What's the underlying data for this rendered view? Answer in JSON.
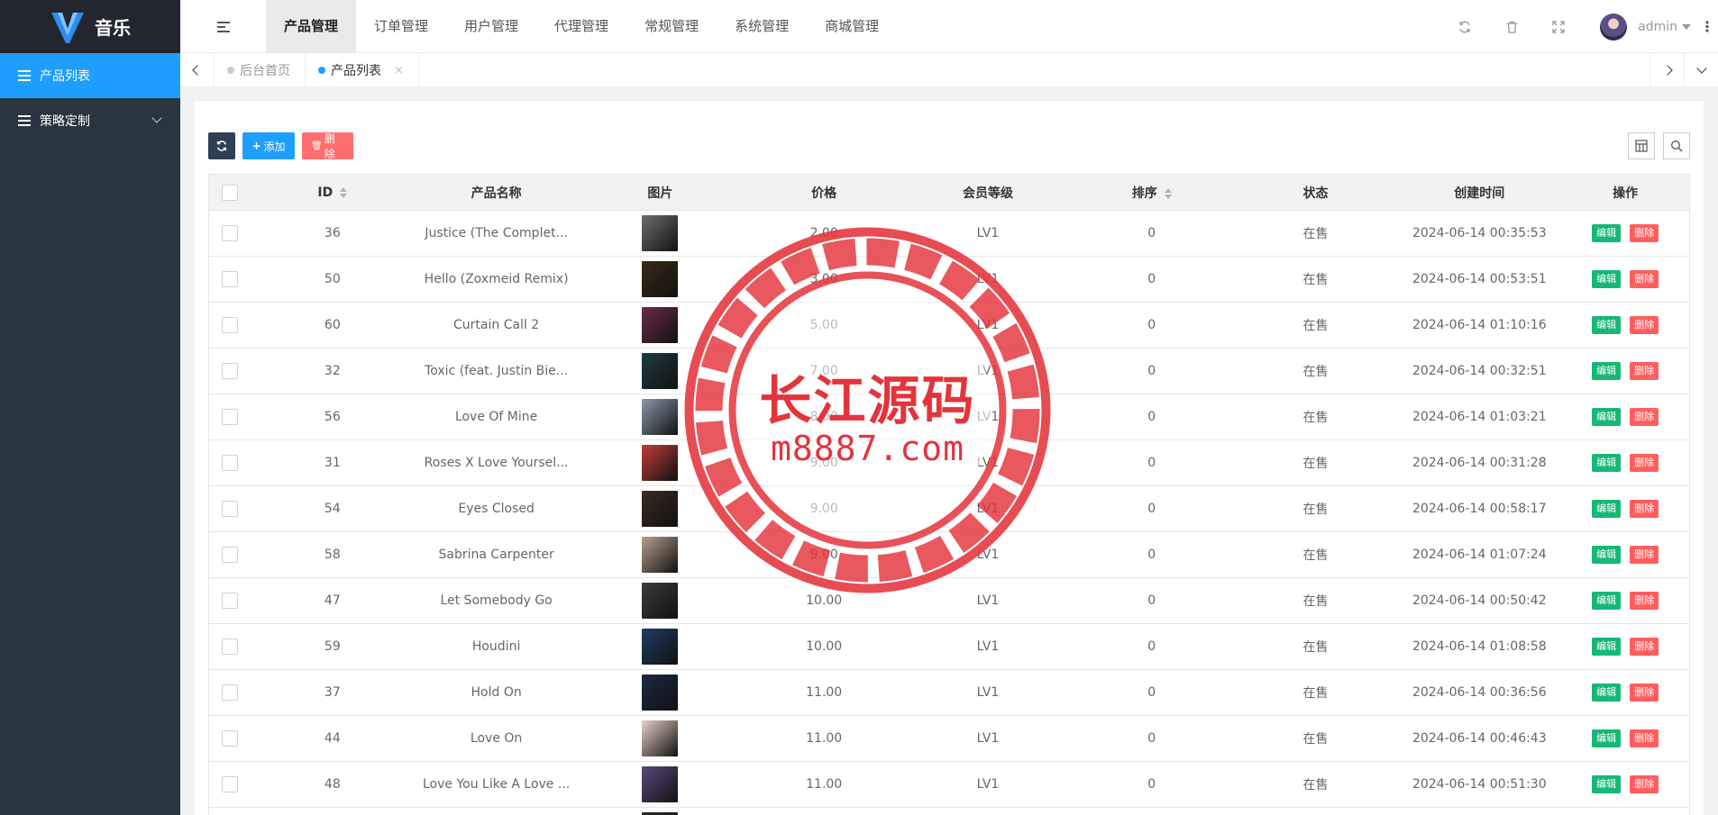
{
  "app": {
    "title": "音乐"
  },
  "sidebar": {
    "items": [
      {
        "label": "产品列表"
      },
      {
        "label": "策略定制"
      }
    ]
  },
  "header": {
    "nav": [
      "产品管理",
      "订单管理",
      "用户管理",
      "代理管理",
      "常规管理",
      "系统管理",
      "商城管理"
    ],
    "username": "admin",
    "more": "⋮"
  },
  "tabs": {
    "items": [
      {
        "label": "后台首页"
      },
      {
        "label": "产品列表",
        "close": "×"
      }
    ]
  },
  "toolbar": {
    "add_label": "添加",
    "delete_label": "删除",
    "add_glyph": "+",
    "delete_glyph": "🗑"
  },
  "table": {
    "headers": {
      "id": "ID",
      "name": "产品名称",
      "image": "图片",
      "price": "价格",
      "level": "会员等级",
      "sort": "排序",
      "status": "状态",
      "created": "创建时间",
      "action": "操作"
    },
    "edit_label": "编辑",
    "delete_label": "删除",
    "rows": [
      {
        "id": "36",
        "name": "Justice (The Complet...",
        "price": "2.00",
        "level": "LV1",
        "sort": "0",
        "status": "在售",
        "created": "2024-06-14 00:35:53",
        "thumb_color": "#6e6e6e"
      },
      {
        "id": "50",
        "name": "Hello (Zoxmeid Remix)",
        "price": "3.00",
        "level": "LV1",
        "sort": "0",
        "status": "在售",
        "created": "2024-06-14 00:53:51",
        "thumb_color": "#3a2a14"
      },
      {
        "id": "60",
        "name": "Curtain Call 2",
        "price": "5.00",
        "level": "LV1",
        "sort": "0",
        "status": "在售",
        "created": "2024-06-14 01:10:16",
        "thumb_color": "#6b2a4a"
      },
      {
        "id": "32",
        "name": "Toxic (feat. Justin Bie...",
        "price": "7.00",
        "level": "LV1",
        "sort": "0",
        "status": "在售",
        "created": "2024-06-14 00:32:51",
        "thumb_color": "#1f3b44"
      },
      {
        "id": "56",
        "name": "Love Of Mine",
        "price": "8.00",
        "level": "LV1",
        "sort": "0",
        "status": "在售",
        "created": "2024-06-14 01:03:21",
        "thumb_color": "#8a9aab"
      },
      {
        "id": "31",
        "name": "Roses X Love Yoursel...",
        "price": "9.00",
        "level": "LV1",
        "sort": "0",
        "status": "在售",
        "created": "2024-06-14 00:31:28",
        "thumb_color": "#c23b3b"
      },
      {
        "id": "54",
        "name": "Eyes Closed",
        "price": "9.00",
        "level": "LV1",
        "sort": "0",
        "status": "在售",
        "created": "2024-06-14 00:58:17",
        "thumb_color": "#3b2a22"
      },
      {
        "id": "58",
        "name": "Sabrina Carpenter",
        "price": "9.00",
        "level": "LV1",
        "sort": "0",
        "status": "在售",
        "created": "2024-06-14 01:07:24",
        "thumb_color": "#b79e8c"
      },
      {
        "id": "47",
        "name": "Let Somebody Go",
        "price": "10.00",
        "level": "LV1",
        "sort": "0",
        "status": "在售",
        "created": "2024-06-14 00:50:42",
        "thumb_color": "#3c3c3c"
      },
      {
        "id": "59",
        "name": "Houdini",
        "price": "10.00",
        "level": "LV1",
        "sort": "0",
        "status": "在售",
        "created": "2024-06-14 01:08:58",
        "thumb_color": "#1f3d63"
      },
      {
        "id": "37",
        "name": "Hold On",
        "price": "11.00",
        "level": "LV1",
        "sort": "0",
        "status": "在售",
        "created": "2024-06-14 00:36:56",
        "thumb_color": "#1b2a44"
      },
      {
        "id": "44",
        "name": "Love On",
        "price": "11.00",
        "level": "LV1",
        "sort": "0",
        "status": "在售",
        "created": "2024-06-14 00:46:43",
        "thumb_color": "#e7cfc4"
      },
      {
        "id": "48",
        "name": "Love You Like A Love ...",
        "price": "11.00",
        "level": "LV1",
        "sort": "0",
        "status": "在售",
        "created": "2024-06-14 00:51:30",
        "thumb_color": "#5b4a7c"
      },
      {
        "id": "",
        "name": "",
        "price": "",
        "level": "",
        "sort": "",
        "status": "",
        "created": "",
        "thumb_color": "#2a2a2a"
      }
    ]
  },
  "watermark": {
    "title": "长江源码",
    "url": "m8887.com",
    "color": "#e4333b"
  },
  "colors": {
    "accent": "#1e9fff",
    "sidebar_bg": "#2a3542",
    "edit_green": "#16b777",
    "delete_red": "#ff5e5e"
  }
}
